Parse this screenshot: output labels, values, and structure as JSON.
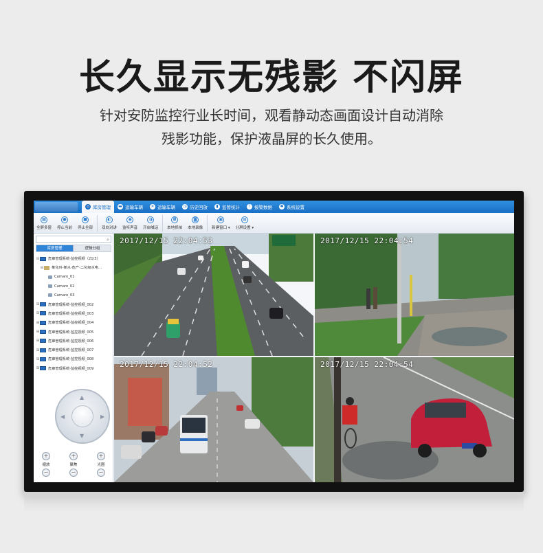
{
  "hero": {
    "title": "长久显示无残影 不闪屏",
    "subtitle_line1": "针对安防监控行业长时间，观看静动态画面设计自动消除",
    "subtitle_line2": "残影功能，保护液晶屏的长久使用。"
  },
  "app": {
    "menu": [
      {
        "label": "库房管理",
        "icon": "warehouse-icon"
      },
      {
        "label": "运输车辆",
        "icon": "truck-icon"
      },
      {
        "label": "运输车辆",
        "icon": "tools-icon"
      },
      {
        "label": "历史回放",
        "icon": "history-icon"
      },
      {
        "label": "监管统计",
        "icon": "stats-icon"
      },
      {
        "label": "报警数据",
        "icon": "alarm-icon"
      },
      {
        "label": "系统设置",
        "icon": "gear-icon"
      }
    ],
    "toolbar": {
      "full_multi": "全屏多窗",
      "stop_current": "停止当前",
      "stop_all": "停止全部",
      "two_way_talk": "双向对讲",
      "listen_sound": "监听声音",
      "open_broadcast": "开启喊话",
      "local_capture": "本地抓拍",
      "local_record": "本地录像",
      "new_window": "新建窗口 ▾",
      "split_settings": "分屏设置 ▾"
    },
    "panel_tabs": {
      "warehouse": "库房管理",
      "logic_group": "逻辑分组"
    },
    "tree": {
      "root": "危审管理系统-监控视频（21/3）",
      "sub": "某化州-某水-危产-二化级水电…",
      "cameras": [
        "Camaro_01",
        "Camaro_02",
        "Camaro_03"
      ],
      "groups": [
        "危审管理系统-监控视频_002",
        "危审管理系统-监控视频_003",
        "危审管理系统-监控视频_004",
        "危审管理系统-监控视频_005",
        "危审管理系统-监控视频_006",
        "危审管理系统-监控视频_007",
        "危审管理系统-监控视频_008",
        "危审管理系统-监控视频_009"
      ]
    },
    "ptz": {
      "zoom": "缩放",
      "focus": "聚焦",
      "iris": "光圈"
    },
    "videos": {
      "v1_time": "2017/12/15  22:04:53",
      "v2_time": "2017/12/15  22:04:54",
      "v3_time": "2017/12/15  22:04:52",
      "v4_time": "2017/12/15  22:04:54"
    }
  }
}
